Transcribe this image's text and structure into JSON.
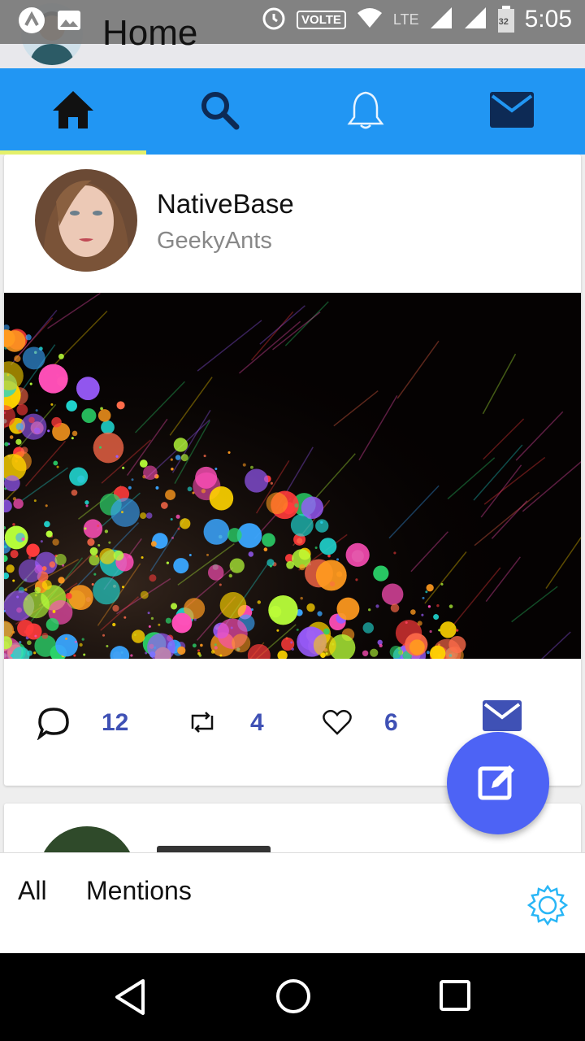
{
  "status_bar": {
    "time": "5:05",
    "volte": "VOLTE",
    "network": "LTE",
    "battery": "32"
  },
  "header": {
    "title": "Home"
  },
  "tabs": [
    {
      "icon": "home-icon",
      "active": true
    },
    {
      "icon": "search-icon",
      "active": false
    },
    {
      "icon": "bell-icon",
      "active": false
    },
    {
      "icon": "mail-icon",
      "active": false
    }
  ],
  "post": {
    "name": "NativeBase",
    "handle": "GeekyAnts",
    "comments": "12",
    "retweets": "4",
    "likes": "6"
  },
  "footer": {
    "all_label": "All",
    "mentions_label": "Mentions"
  },
  "colors": {
    "primary": "#2196f3",
    "tab_indicator": "#e4f06b",
    "fab": "#4d63f5",
    "count": "#3f51b5"
  }
}
